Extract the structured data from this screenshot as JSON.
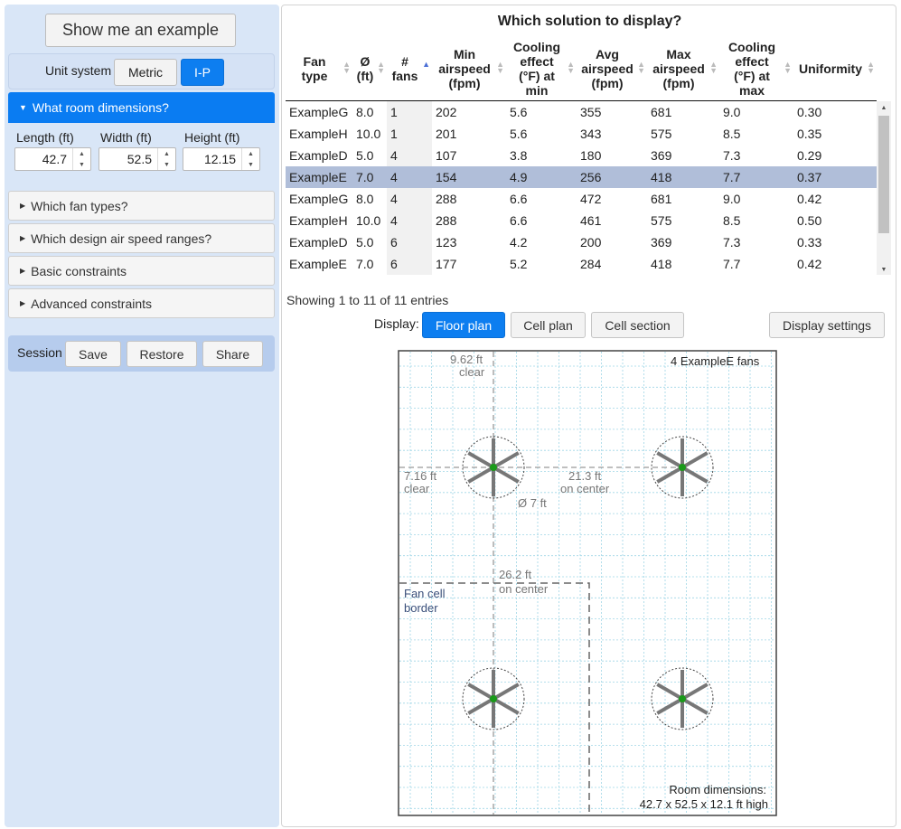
{
  "left": {
    "example_button": "Show me an example",
    "unit_system": {
      "label": "Unit system",
      "metric": "Metric",
      "ip": "I-P"
    },
    "room_dims": {
      "heading": "What room dimensions?",
      "length": {
        "label": "Length (ft)",
        "value": "42.7"
      },
      "width": {
        "label": "Width (ft)",
        "value": "52.5"
      },
      "height": {
        "label": "Height (ft)",
        "value": "12.15"
      }
    },
    "sections": [
      "Which fan types?",
      "Which design air speed ranges?",
      "Basic constraints",
      "Advanced constraints"
    ],
    "session": {
      "label": "Session",
      "save": "Save",
      "restore": "Restore",
      "share": "Share"
    }
  },
  "main": {
    "title": "Which solution to display?",
    "columns": [
      {
        "lines": [
          "Fan",
          "type"
        ]
      },
      {
        "lines": [
          "Ø",
          "(ft)"
        ]
      },
      {
        "lines": [
          "#",
          "fans"
        ]
      },
      {
        "lines": [
          "Min",
          "airspeed",
          "(fpm)"
        ]
      },
      {
        "lines": [
          "Cooling",
          "effect",
          "(°F) at",
          "min"
        ]
      },
      {
        "lines": [
          "Avg",
          "airspeed",
          "(fpm)"
        ]
      },
      {
        "lines": [
          "Max",
          "airspeed",
          "(fpm)"
        ]
      },
      {
        "lines": [
          "Cooling",
          "effect",
          "(°F) at",
          "max"
        ]
      },
      {
        "lines": [
          "Uniformity"
        ]
      }
    ],
    "rows": [
      [
        "ExampleG",
        "8.0",
        "1",
        "202",
        "5.6",
        "355",
        "681",
        "9.0",
        "0.30"
      ],
      [
        "ExampleH",
        "10.0",
        "1",
        "201",
        "5.6",
        "343",
        "575",
        "8.5",
        "0.35"
      ],
      [
        "ExampleD",
        "5.0",
        "4",
        "107",
        "3.8",
        "180",
        "369",
        "7.3",
        "0.29"
      ],
      [
        "ExampleE",
        "7.0",
        "4",
        "154",
        "4.9",
        "256",
        "418",
        "7.7",
        "0.37"
      ],
      [
        "ExampleG",
        "8.0",
        "4",
        "288",
        "6.6",
        "472",
        "681",
        "9.0",
        "0.42"
      ],
      [
        "ExampleH",
        "10.0",
        "4",
        "288",
        "6.6",
        "461",
        "575",
        "8.5",
        "0.50"
      ],
      [
        "ExampleD",
        "5.0",
        "6",
        "123",
        "4.2",
        "200",
        "369",
        "7.3",
        "0.33"
      ],
      [
        "ExampleE",
        "7.0",
        "6",
        "177",
        "5.2",
        "284",
        "418",
        "7.7",
        "0.42"
      ]
    ],
    "selected_row": 3,
    "info": "Showing 1 to 11 of 11 entries",
    "display": {
      "label": "Display:",
      "floor_plan": "Floor plan",
      "cell_plan": "Cell plan",
      "cell_section": "Cell section",
      "settings": "Display settings"
    }
  },
  "floor_plan": {
    "fan_count_label": "4 ExampleE fans",
    "clear_top": [
      "9.62 ft",
      "clear"
    ],
    "clear_left": [
      "7.16 ft",
      "clear"
    ],
    "spacing_x": [
      "21.3 ft",
      "on center"
    ],
    "diameter": "Ø 7 ft",
    "spacing_y": [
      "26.2 ft",
      "on center"
    ],
    "cell_border": [
      "Fan cell",
      "border"
    ],
    "room_dims": [
      "Room dimensions:",
      "42.7 x 52.5 x 12.1 ft high"
    ],
    "colors": {
      "grid": "#9fd6e6",
      "fan_center": "#1a9a1a",
      "blade": "#777777",
      "cell_border": "#555555"
    }
  }
}
